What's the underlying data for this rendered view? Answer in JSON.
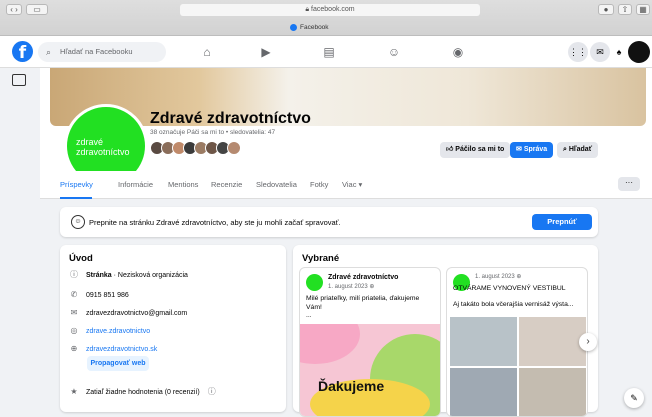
{
  "browser": {
    "url": "facebook.com",
    "tab_title": "Facebook"
  },
  "fb_nav": {
    "logo": "f",
    "search_placeholder": "Hľadať na Facebooku"
  },
  "page": {
    "avatar_text": "zdravé zdravotníctvo",
    "name": "Zdravé zdravotníctvo",
    "stats": "38 označuje Páči sa mi to • sledovatelia: 47",
    "buttons": {
      "like": "Páčilo sa mi to",
      "message": "Správa",
      "search": "Hľadať"
    }
  },
  "tabs": [
    "Príspevky",
    "Informácie",
    "Mentions",
    "Recenzie",
    "Sledovatelia",
    "Fotky",
    "Viac ▾"
  ],
  "more_label": "···",
  "switch_banner": {
    "text": "Prepnite na stránku Zdravé zdravotníctvo, aby ste ju mohli začať spravovať.",
    "button": "Prepnúť"
  },
  "intro": {
    "title": "Úvod",
    "category_bold": "Stránka",
    "category": "· Nezisková organizácia",
    "phone": "0915 851 986",
    "email": "zdravezdravotnictvo@gmail.com",
    "instagram": "zdrave.zdravotnictvo",
    "website": "zdravezdravotnictvo.sk",
    "promote": "Propagovať web",
    "rating": "Zatiaľ žiadne hodnotenia (0 recenzií)"
  },
  "featured": {
    "title": "Vybrané",
    "posts": [
      {
        "author": "Zdravé zdravotníctvo",
        "date": "1. august 2023",
        "text": "Milé priateľky, milí priatelia, ďakujeme Vám!",
        "ellipsis": "...",
        "image_word": "Ďakujeme"
      },
      {
        "date": "1. august 2023",
        "headline": "OTVÁRAME VYNOVENÝ VESTIBUL",
        "text": "Aj takáto bola včerajšia vernisáž výsta..."
      }
    ]
  },
  "icons": {
    "next": "chevron-right-icon",
    "compose": "edit-icon"
  }
}
